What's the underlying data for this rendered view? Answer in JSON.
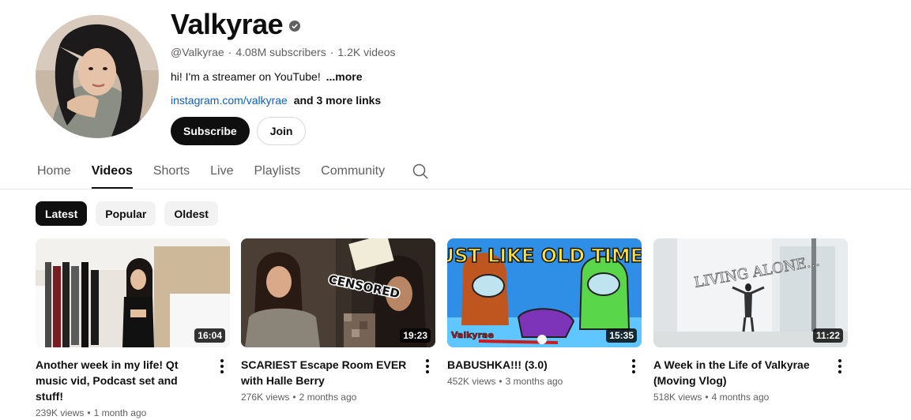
{
  "channel": {
    "name": "Valkyrae",
    "handle": "@Valkyrae",
    "subscribers": "4.08M subscribers",
    "videos_count": "1.2K videos",
    "description": "hi! I'm a streamer on YouTube!",
    "more_label": "...more",
    "link": "instagram.com/valkyrae",
    "more_links": "and 3 more links",
    "subscribe_label": "Subscribe",
    "join_label": "Join"
  },
  "tabs": [
    {
      "label": "Home",
      "active": false
    },
    {
      "label": "Videos",
      "active": true
    },
    {
      "label": "Shorts",
      "active": false
    },
    {
      "label": "Live",
      "active": false
    },
    {
      "label": "Playlists",
      "active": false
    },
    {
      "label": "Community",
      "active": false
    }
  ],
  "chips": [
    {
      "label": "Latest",
      "active": true
    },
    {
      "label": "Popular",
      "active": false
    },
    {
      "label": "Oldest",
      "active": false
    }
  ],
  "videos": [
    {
      "title": "Another week in my life! Qt music vid, Podcast set and stuff!",
      "views": "239K views",
      "age": "1 month ago",
      "duration": "16:04"
    },
    {
      "title": "SCARIEST Escape Room EVER with Halle Berry",
      "views": "276K views",
      "age": "2 months ago",
      "duration": "19:23",
      "thumb_text": "CENSORED"
    },
    {
      "title": "BABUSHKA!!! (3.0)",
      "views": "452K views",
      "age": "3 months ago",
      "duration": "15:35",
      "thumb_text": "JUST LIKE OLD TIMES",
      "thumb_sub": "Valkyrae"
    },
    {
      "title": "A Week in the Life of Valkyrae (Moving Vlog)",
      "views": "518K views",
      "age": "4 months ago",
      "duration": "11:22",
      "thumb_text": "LIVING ALONE..."
    }
  ],
  "colors": {
    "accent": "#0f0f0f",
    "link": "#065fd4",
    "muted": "#606060"
  }
}
